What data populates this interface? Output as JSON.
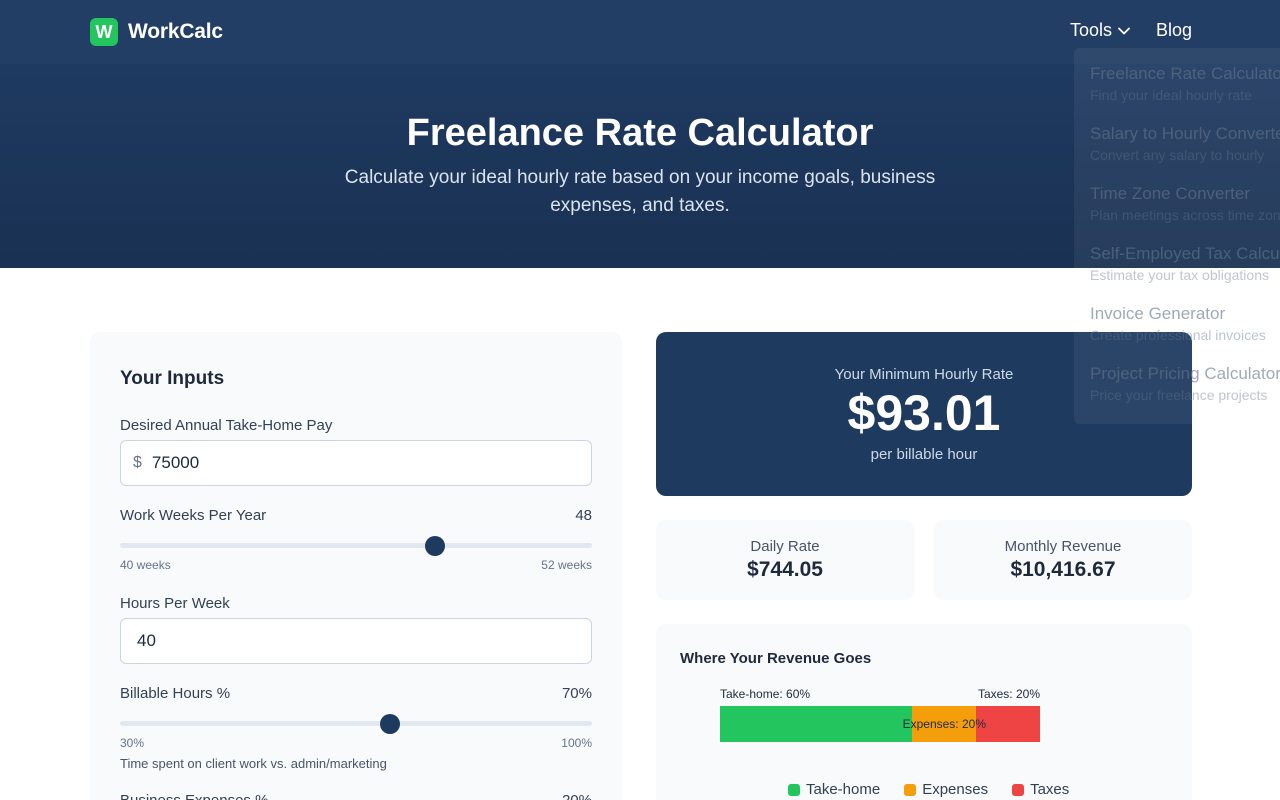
{
  "header": {
    "brand_logo_letter": "W",
    "brand_name": "WorkCalc",
    "nav_tools": "Tools",
    "nav_blog": "Blog"
  },
  "hero": {
    "title": "Freelance Rate Calculator",
    "subtitle": "Calculate your ideal hourly rate based on your income goals, business expenses, and taxes."
  },
  "inputs": {
    "title": "Your Inputs",
    "annual_pay_label": "Desired Annual Take-Home Pay",
    "annual_pay_prefix": "$",
    "annual_pay_value": "75000",
    "weeks_label": "Work Weeks Per Year",
    "weeks_value": "48",
    "weeks_slider": {
      "value": 48,
      "min": 40,
      "max": 52
    },
    "weeks_min_label": "40 weeks",
    "weeks_max_label": "52 weeks",
    "hours_label": "Hours Per Week",
    "hours_value": "40",
    "billable_label": "Billable Hours %",
    "billable_value": "70%",
    "billable_slider": {
      "value": 70,
      "min": 30,
      "max": 100
    },
    "billable_min_label": "30%",
    "billable_max_label": "100%",
    "billable_hint": "Time spent on client work vs. admin/marketing",
    "expenses_label": "Business Expenses %",
    "expenses_value": "20%"
  },
  "result": {
    "label": "Your Minimum Hourly Rate",
    "value": "$93.01",
    "unit": "per billable hour"
  },
  "stats": {
    "daily_label": "Daily Rate",
    "daily_value": "$744.05",
    "monthly_label": "Monthly Revenue",
    "monthly_value": "$10,416.67"
  },
  "revenue": {
    "title": "Where Your Revenue Goes"
  },
  "chart_data": {
    "type": "bar",
    "title": "Where Your Revenue Goes",
    "orientation": "horizontal-stacked",
    "categories": [
      "Take-home",
      "Expenses",
      "Taxes"
    ],
    "values": [
      60,
      20,
      20
    ],
    "unit": "%",
    "data_labels": [
      "Take-home: 60%",
      "Expenses: 20%",
      "Taxes: 20%"
    ],
    "colors": [
      "#22c55e",
      "#f59e0b",
      "#ef4444"
    ],
    "legend": "bottom"
  },
  "dropdown": {
    "items": [
      {
        "title": "Freelance Rate Calculator",
        "desc": "Find your ideal hourly rate"
      },
      {
        "title": "Salary to Hourly Converter",
        "desc": "Convert any salary to hourly"
      },
      {
        "title": "Time Zone Converter",
        "desc": "Plan meetings across time zones"
      },
      {
        "title": "Self-Employed Tax Calculator",
        "desc": "Estimate your tax obligations"
      },
      {
        "title": "Invoice Generator",
        "desc": "Create professional invoices"
      },
      {
        "title": "Project Pricing Calculator",
        "desc": "Price your freelance projects"
      }
    ]
  },
  "colors": {
    "navy": "#1e3a5f",
    "accent_green": "#22c55e"
  }
}
